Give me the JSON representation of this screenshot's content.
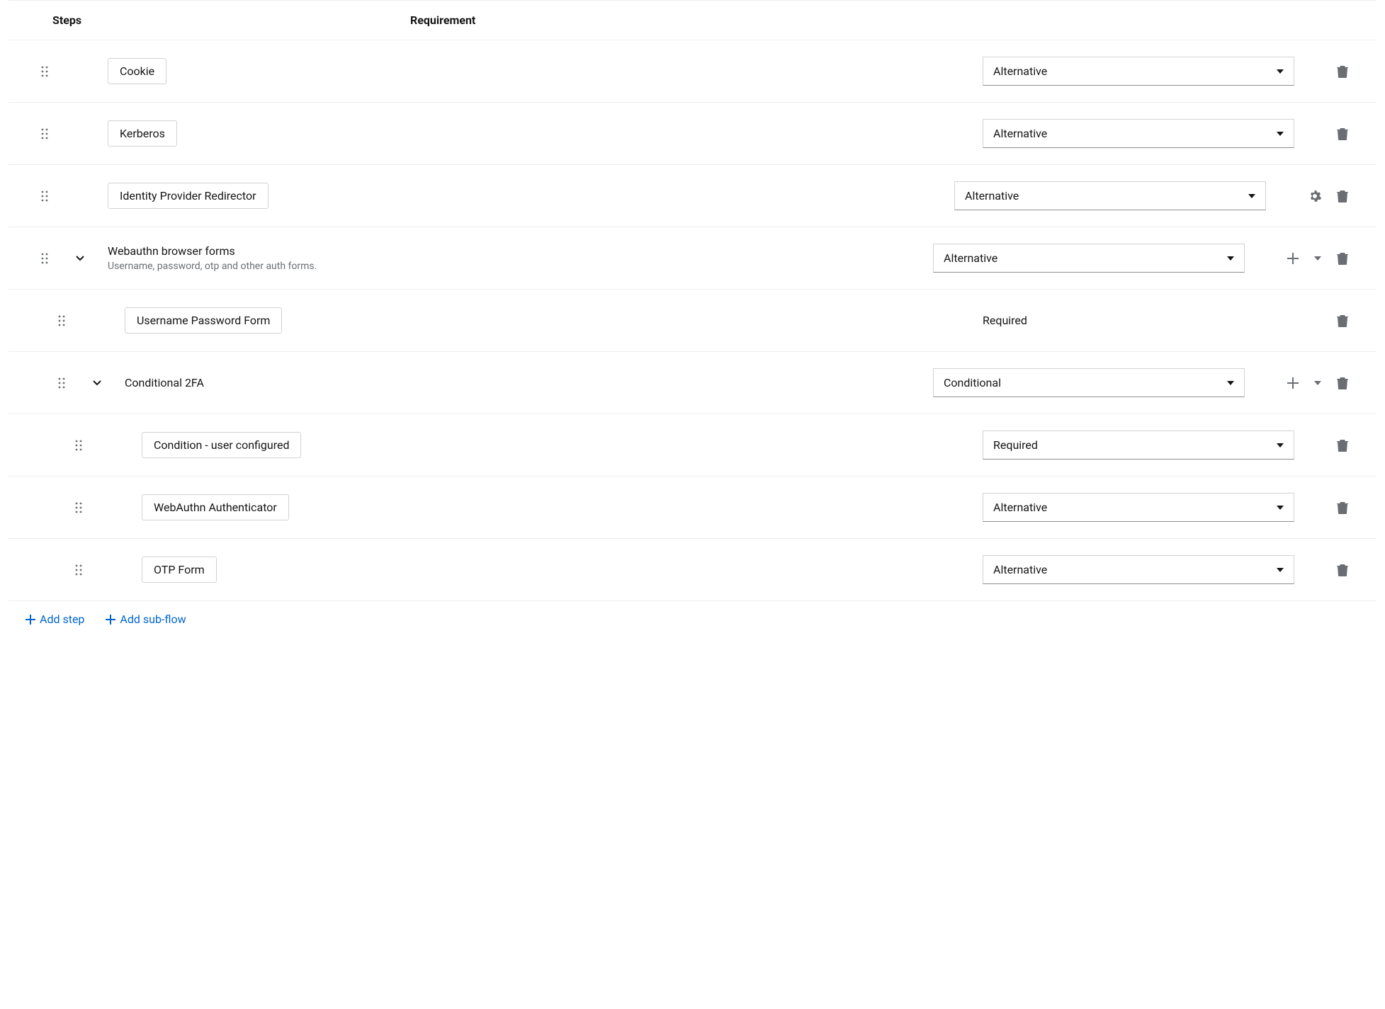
{
  "headers": {
    "steps": "Steps",
    "requirement": "Requirement"
  },
  "rows": [
    {
      "label": "Cookie",
      "requirement": "Alternative"
    },
    {
      "label": "Kerberos",
      "requirement": "Alternative"
    },
    {
      "label": "Identity Provider Redirector",
      "requirement": "Alternative"
    },
    {
      "title": "Webauthn browser forms",
      "description": "Username, password, otp and other auth forms.",
      "requirement": "Alternative"
    },
    {
      "label": "Username Password Form",
      "requirement": "Required"
    },
    {
      "title": "Conditional 2FA",
      "requirement": "Conditional"
    },
    {
      "label": "Condition - user configured",
      "requirement": "Required"
    },
    {
      "label": "WebAuthn Authenticator",
      "requirement": "Alternative"
    },
    {
      "label": "OTP Form",
      "requirement": "Alternative"
    }
  ],
  "footer": {
    "add_step": "Add step",
    "add_subflow": "Add sub-flow"
  }
}
